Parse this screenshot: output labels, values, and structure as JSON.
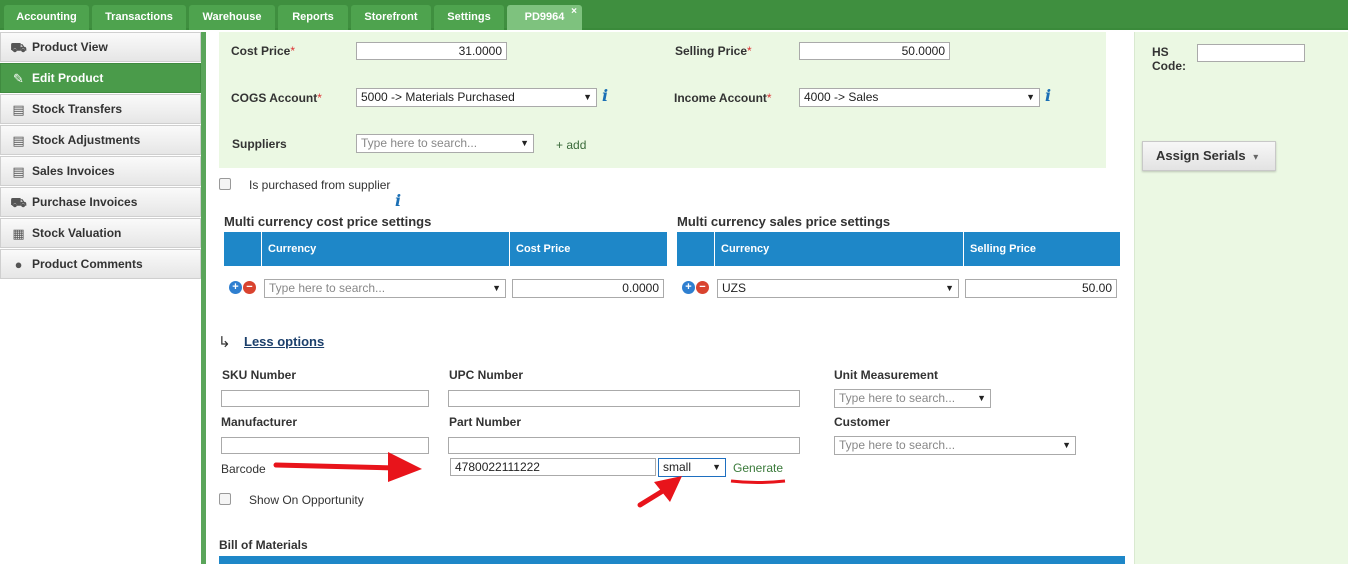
{
  "top_tabs": [
    {
      "label": "Accounting"
    },
    {
      "label": "Transactions"
    },
    {
      "label": "Warehouse"
    },
    {
      "label": "Reports"
    },
    {
      "label": "Storefront"
    },
    {
      "label": "Settings"
    },
    {
      "label": "PD9964",
      "close": "×"
    }
  ],
  "sidebar": {
    "items": [
      {
        "label": "Product View",
        "icon": "truck-icon"
      },
      {
        "label": "Edit Product",
        "icon": "edit-icon"
      },
      {
        "label": "Stock Transfers",
        "icon": "document-icon"
      },
      {
        "label": "Stock Adjustments",
        "icon": "document-icon"
      },
      {
        "label": "Sales Invoices",
        "icon": "document-icon"
      },
      {
        "label": "Purchase Invoices",
        "icon": "truck-icon"
      },
      {
        "label": "Stock Valuation",
        "icon": "calculator-icon"
      },
      {
        "label": "Product Comments",
        "icon": "comment-icon"
      }
    ]
  },
  "price": {
    "cost_price_label": "Cost Price",
    "cost_price_value": "31.0000",
    "selling_price_label": "Selling Price",
    "selling_price_value": "50.0000",
    "required_mark": "*",
    "cogs_label": "COGS Account",
    "cogs_value": "5000 -> Materials Purchased",
    "income_label": "Income Account",
    "income_value": "4000 -> Sales",
    "suppliers_label": "Suppliers",
    "suppliers_placeholder": "Type here to search...",
    "add_link": "+ add",
    "info_glyph": "i"
  },
  "hs_code": {
    "label_line1": "HS",
    "label_line2": "Code:",
    "value": ""
  },
  "assign_serials": {
    "label": "Assign Serials",
    "caret": "▾"
  },
  "purchased_checkbox_label": "Is purchased from supplier",
  "multi_cost": {
    "title": "Multi currency cost price settings",
    "col_currency": "Currency",
    "col_price": "Cost Price",
    "currency_placeholder": "Type here to search...",
    "price_value": "0.0000"
  },
  "multi_sales": {
    "title": "Multi currency sales price settings",
    "col_currency": "Currency",
    "col_price": "Selling Price",
    "currency_value": "UZS",
    "price_value": "50.00"
  },
  "less_options": {
    "arrow": "↳",
    "label": "Less options"
  },
  "extra": {
    "sku_label": "SKU Number",
    "upc_label": "UPC Number",
    "unit_label": "Unit Measurement",
    "unit_placeholder": "Type here to search...",
    "manufacturer_label": "Manufacturer",
    "part_label": "Part Number",
    "customer_label": "Customer",
    "customer_placeholder": "Type here to search...",
    "barcode_label": "Barcode",
    "barcode_value": "4780022111222",
    "barcode_size": "small",
    "generate_label": "Generate",
    "show_opportunity_label": "Show On Opportunity"
  },
  "bom_title": "Bill of Materials",
  "colors": {
    "green": "#3f8f3f",
    "panel": "#ebf8e3",
    "blue": "#1e87c8",
    "red_annotation": "#e8141b"
  }
}
